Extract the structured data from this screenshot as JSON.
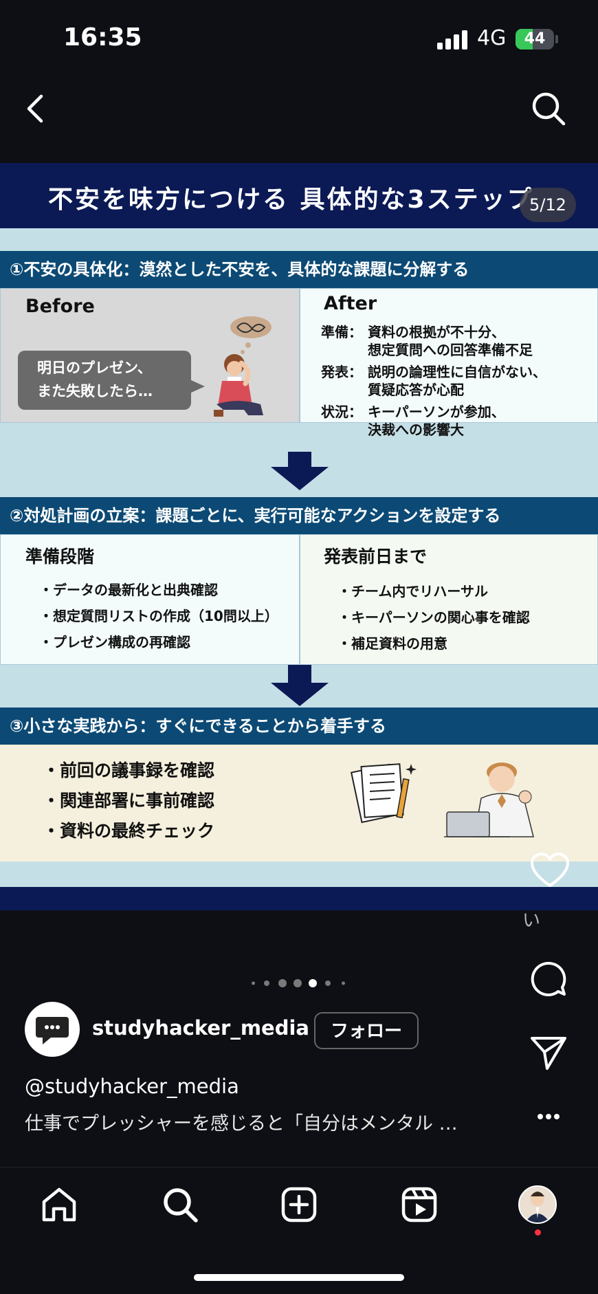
{
  "status_bar": {
    "time": "16:35",
    "network": "4G",
    "battery": "44",
    "battery_level_percent": 44
  },
  "post": {
    "title": "不安を味方につける 具体的な3ステップ",
    "slide_counter": "5/12",
    "step1": {
      "heading": "①不安の具体化：漠然とした不安を、具体的な課題に分解する",
      "before_label": "Before",
      "speech_line1": "明日のプレゼン、",
      "speech_line2": "また失敗したら…",
      "after_label": "After",
      "items": [
        {
          "key": "準備：",
          "line1": "資料の根拠が不十分、",
          "line2": "想定質問への回答準備不足"
        },
        {
          "key": "発表：",
          "line1": "説明の論理性に自信がない、",
          "line2": "質疑応答が心配"
        },
        {
          "key": "状況：",
          "line1": "キーパーソンが参加、",
          "line2": "決裁への影響大"
        }
      ]
    },
    "step2": {
      "heading": "②対処計画の立案：課題ごとに、実行可能なアクションを設定する",
      "left_title": "準備段階",
      "left_items": [
        "・データの最新化と出典確認",
        "・想定質問リストの作成（10問以上）",
        "・プレゼン構成の再確認"
      ],
      "right_title": "発表前日まで",
      "right_items": [
        "・チーム内でリハーサル",
        "・キーパーソンの関心事を確認",
        "・補足資料の用意"
      ]
    },
    "step3": {
      "heading": "③小さな実践から：すぐにできることから着手する",
      "items": [
        "・前回の議事録を確認",
        "・関連部署に事前確認",
        "・資料の最終チェック"
      ]
    }
  },
  "actions": {
    "like_count_stub": "い"
  },
  "carousel": {
    "active_index": 4,
    "total_visible_dots": 7
  },
  "profile": {
    "username": "studyhacker_media",
    "follow_label": "フォロー",
    "handle": "@studyhacker_media",
    "caption": "仕事でプレッシャーを感じると「自分はメンタル …"
  },
  "tabbar": {
    "items": [
      "home-icon",
      "search-icon",
      "create-icon",
      "reels-icon",
      "profile-avatar"
    ]
  },
  "colors": {
    "navy": "#0b1a55",
    "step_header": "#0c4a75",
    "light_blue_bg": "#c5dfe6",
    "cream": "#f5f0dd"
  }
}
